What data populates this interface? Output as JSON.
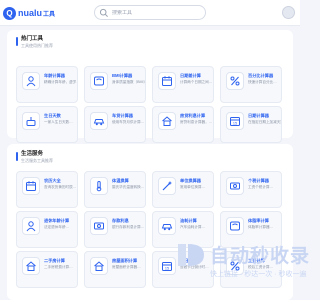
{
  "header": {
    "logo_text": "nualu",
    "logo_suffix": "工具",
    "search_placeholder": "搜索工具"
  },
  "sections": [
    {
      "title": "热门工具",
      "subtitle": "工具使用热门推荐",
      "cards": [
        {
          "title": "年龄计算器",
          "desc": "精确计算年龄，虚岁…",
          "icon": "person-icon"
        },
        {
          "title": "BMI计算器",
          "desc": "身体质量指数（BMI）计…",
          "icon": "scale-icon"
        },
        {
          "title": "日期差计算",
          "desc": "计算两个日期之间…",
          "icon": "calendar-icon"
        },
        {
          "title": "百分比计算器",
          "desc": "快速计算百分比…",
          "icon": "percent-icon"
        },
        {
          "title": "生日天数",
          "desc": "一家人生日天数…",
          "icon": "cake-icon"
        },
        {
          "title": "车贷计算器",
          "desc": "使用车贷月供计算…",
          "icon": "car-icon"
        },
        {
          "title": "房贷利息计算",
          "desc": "房贷利息计算器，…",
          "icon": "house-icon"
        },
        {
          "title": "日期计算器",
          "desc": "在指定日期上加减天数…",
          "icon": "calendar-15-icon"
        }
      ]
    },
    {
      "title": "生活服务",
      "subtitle": "生活服务工具推荐",
      "cards": [
        {
          "title": "农历大全",
          "desc": "查询农历黄历时辰…",
          "icon": "calendar-icon"
        },
        {
          "title": "体温换算",
          "desc": "摄氏华氏温度转换…",
          "icon": "thermo-icon"
        },
        {
          "title": "单位换算器",
          "desc": "常用单位换算…",
          "icon": "wand-icon"
        },
        {
          "title": "个税计算器",
          "desc": "工资个税计算…",
          "icon": "money-icon"
        },
        {
          "title": "退休年龄计算",
          "desc": "法定退休年龄…",
          "icon": "person-icon"
        },
        {
          "title": "存款利息",
          "desc": "银行存款利息计算…",
          "icon": "money-icon"
        },
        {
          "title": "油耗计算",
          "desc": "汽车油耗计算…",
          "icon": "car-icon"
        },
        {
          "title": "体脂率计算",
          "desc": "体脂率计算器…",
          "icon": "scale-icon"
        },
        {
          "title": "二手房计算",
          "desc": "二手房税费计算…",
          "icon": "house-icon"
        },
        {
          "title": "房屋面积计算",
          "desc": "房屋面积计算器…",
          "icon": "house-icon"
        },
        {
          "title": "节日倒计时",
          "desc": "查看节日倒计时…",
          "icon": "calendar-15-icon"
        },
        {
          "title": "工资计算",
          "desc": "税后工资计算…",
          "icon": "percent-icon"
        }
      ]
    }
  ],
  "watermark": {
    "title": "自动秒收录",
    "subtitle": "快上链接 · 秒达一次 · 秒收一遍"
  },
  "colors": {
    "accent": "#2e63f0"
  }
}
